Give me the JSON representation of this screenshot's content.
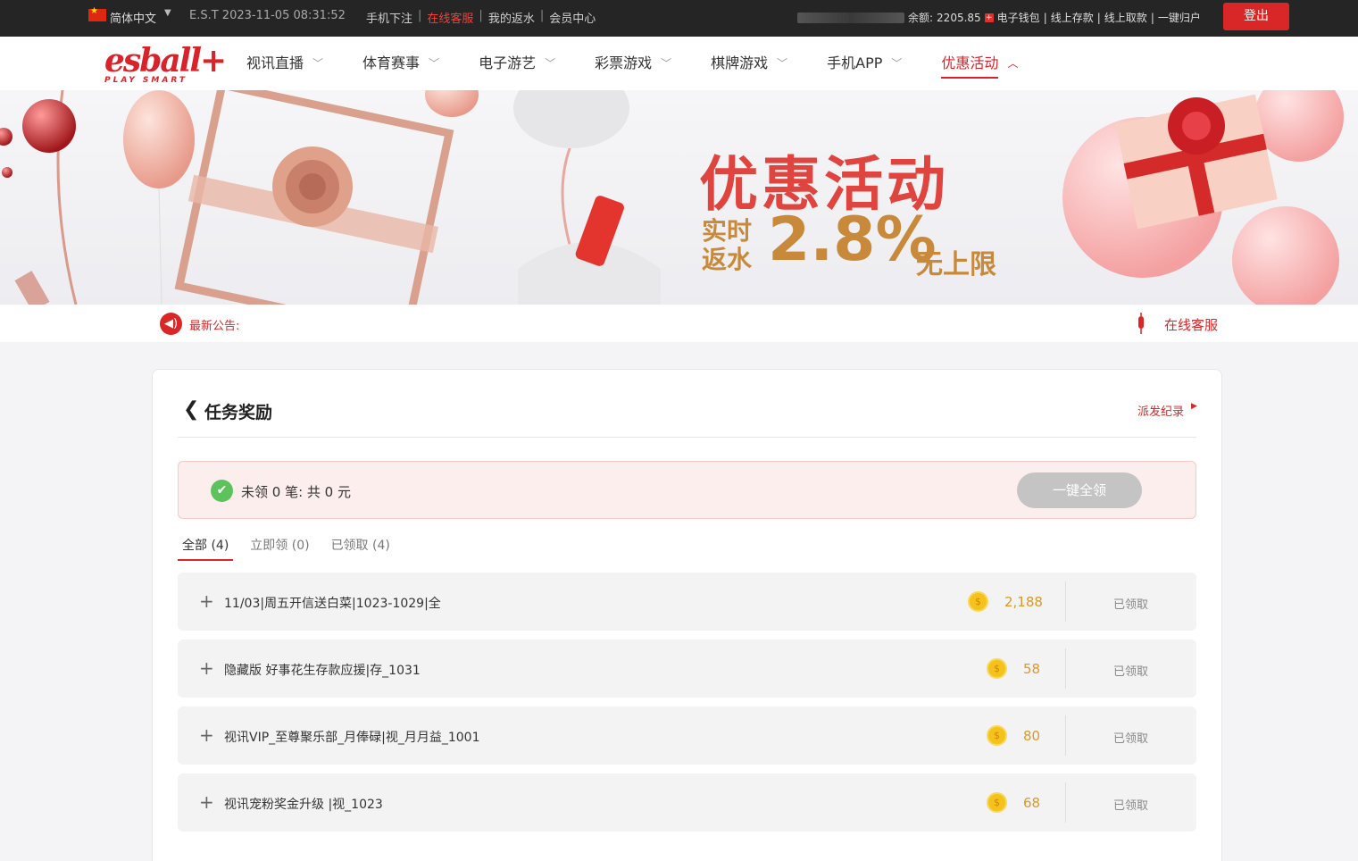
{
  "topbar": {
    "language": "简体中文",
    "clock": "E.S.T 2023-11-05 08:31:52",
    "links": [
      "手机下注",
      "在线客服",
      "我的返水",
      "会员中心"
    ],
    "balance_label": "余额:",
    "balance_value": "2205.85",
    "account_links": [
      "电子钱包",
      "线上存款",
      "线上取款",
      "一键归户"
    ],
    "logout": "登出"
  },
  "nav": {
    "logo_text": "esball+",
    "logo_tag": "PLAY SMART",
    "items": [
      "视讯直播",
      "体育赛事",
      "电子游艺",
      "彩票游戏",
      "棋牌游戏",
      "手机APP",
      "优惠活动"
    ],
    "active_index": 6
  },
  "banner": {
    "title": "优惠活动",
    "sub_line1": "实时",
    "sub_line2": "返水",
    "percent": "2.8%",
    "nolimit": "无上限"
  },
  "notice": {
    "label": "最新公告:",
    "service": "在线客服"
  },
  "card": {
    "title": "任务奖励",
    "history_link": "派发纪录",
    "summary_text": "未领 0 笔: 共 0 元",
    "claim_all": "一键全领",
    "tabs": [
      "全部 (4)",
      "立即领 (0)",
      "已领取 (4)"
    ],
    "rows": [
      {
        "name": "11/03|周五开信送白菜|1023-1029|全",
        "amount": "2,188",
        "status": "已领取"
      },
      {
        "name": "隐藏版 好事花生存款应援|存_1031",
        "amount": "58",
        "status": "已领取"
      },
      {
        "name": "视讯VIP_至尊聚乐部_月俸碌|视_月月益_1001",
        "amount": "80",
        "status": "已领取"
      },
      {
        "name": "视讯宠粉奖金升级 |视_1023",
        "amount": "68",
        "status": "已领取"
      }
    ]
  },
  "colors": {
    "brand_red": "#d92626",
    "gold": "#d79a2b",
    "topbar_bg": "#252525"
  }
}
